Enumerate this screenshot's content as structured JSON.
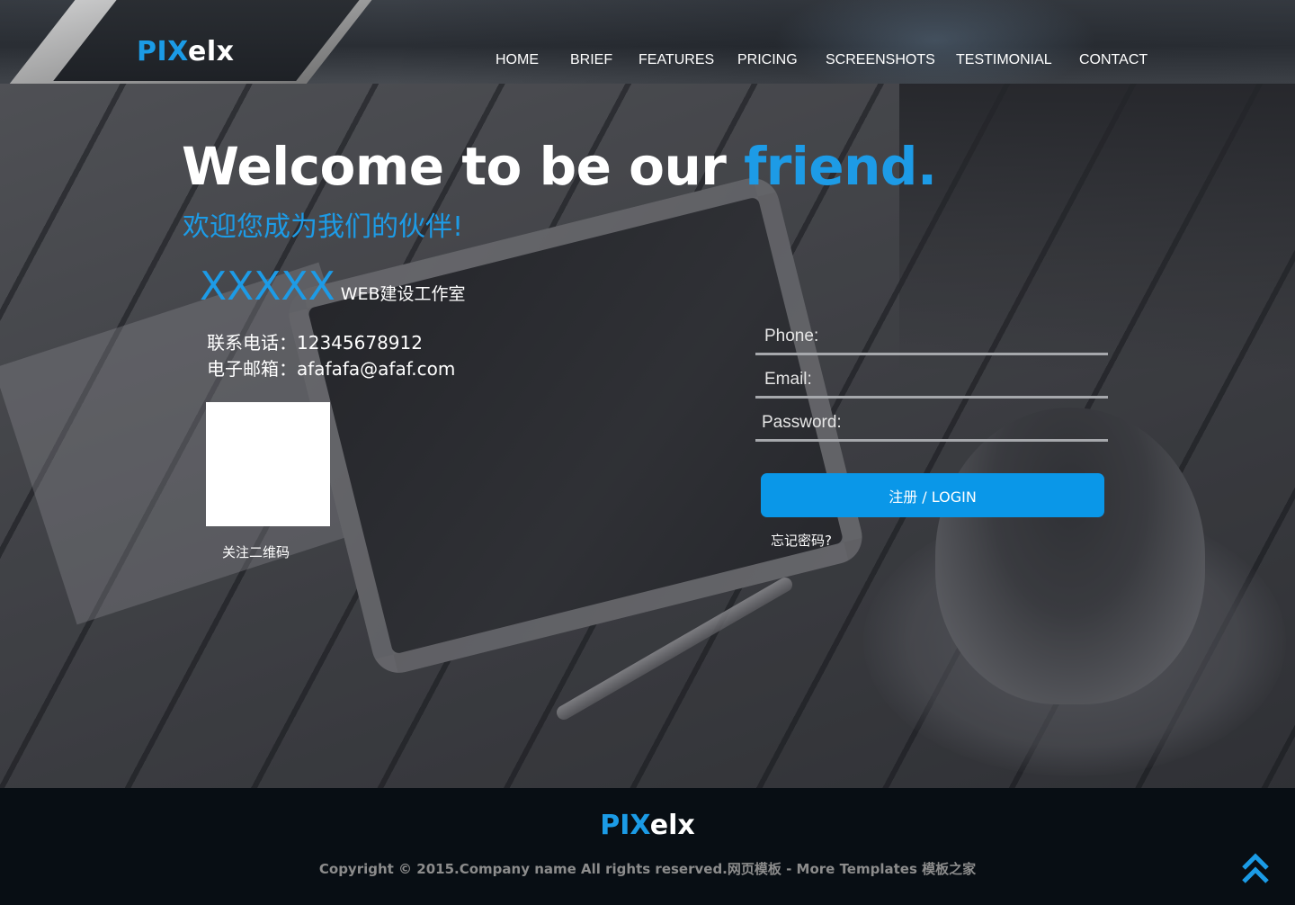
{
  "brand": {
    "logo_blue": "PIX",
    "logo_white": "elx"
  },
  "nav": {
    "items": [
      "HOME",
      "BRIEF",
      "FEATURES",
      "PRICING",
      "SCREENSHOTS",
      "TESTIMONIAL",
      "CONTACT"
    ]
  },
  "hero": {
    "welcome_white": "Welcome to be our ",
    "welcome_blue": "friend.",
    "welcome_cn": "欢迎您成为我们的伙伴!",
    "studio_name": "XXXXX",
    "studio_type": "WEB建设工作室",
    "phone_line": "联系电话：12345678912",
    "email_line": "电子邮箱：afafafa@afaf.com",
    "qr_caption": "关注二维码"
  },
  "form": {
    "phone_placeholder": "Phone:",
    "email_placeholder": "Email:",
    "password_placeholder": "Password:",
    "phone_value": "",
    "email_value": "",
    "password_value": "",
    "login_label": "注册 / LOGIN",
    "forgot_label": "忘记密码?"
  },
  "footer": {
    "logo_blue": "PIX",
    "logo_white": "elx",
    "copyright": "Copyright © 2015.Company name All rights reserved.网页模板 - More Templates 模板之家"
  },
  "icons": {
    "back_to_top": "double-chevron-up-icon"
  },
  "colors": {
    "accent": "#1b9be6",
    "button": "#0a97e8",
    "footer_bg": "#080e14"
  }
}
